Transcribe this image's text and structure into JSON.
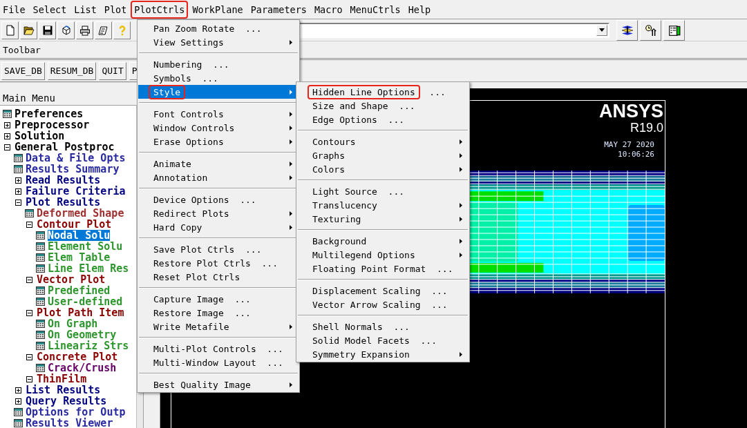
{
  "menubar": [
    {
      "label": "File",
      "highlighted": false
    },
    {
      "label": "Select",
      "highlighted": false
    },
    {
      "label": "List",
      "highlighted": false
    },
    {
      "label": "Plot",
      "highlighted": false
    },
    {
      "label": "PlotCtrls",
      "highlighted": true
    },
    {
      "label": "WorkPlane",
      "highlighted": false
    },
    {
      "label": "Parameters",
      "highlighted": false
    },
    {
      "label": "Macro",
      "highlighted": false
    },
    {
      "label": "MenuCtrls",
      "highlighted": false
    },
    {
      "label": "Help",
      "highlighted": false
    }
  ],
  "toolbar_title": "Toolbar",
  "toolbar_buttons": [
    "SAVE_DB",
    "RESUM_DB",
    "QUIT",
    "P"
  ],
  "main_menu": {
    "title": "Main Menu",
    "items": [
      {
        "label": "Preferences",
        "kind": "leaf",
        "selected": false,
        "color": "#000000"
      },
      {
        "label": "Preprocessor",
        "kind": "branch",
        "expanded": false,
        "selected": false,
        "color": "#000000"
      },
      {
        "label": "Solution",
        "kind": "branch",
        "expanded": false,
        "selected": false,
        "color": "#000000"
      },
      {
        "label": "General Postproc",
        "kind": "branch",
        "expanded": true,
        "selected": false,
        "color": "#000000",
        "children": [
          {
            "label": "Data & File Opts",
            "kind": "leaf",
            "selected": false,
            "color": "#2a2aa0"
          },
          {
            "label": "Results Summary",
            "kind": "leaf",
            "selected": false,
            "color": "#2a2aa0"
          },
          {
            "label": "Read Results",
            "kind": "branch",
            "expanded": false,
            "selected": false,
            "color": "#000080"
          },
          {
            "label": "Failure Criteria",
            "kind": "branch",
            "expanded": false,
            "selected": false,
            "color": "#000080"
          },
          {
            "label": "Plot Results",
            "kind": "branch",
            "expanded": true,
            "selected": false,
            "color": "#000080",
            "children": [
              {
                "label": "Deformed Shape",
                "kind": "leaf",
                "selected": false,
                "color": "#a03030"
              },
              {
                "label": "Contour Plot",
                "kind": "branch",
                "expanded": true,
                "selected": false,
                "color": "#8b0000",
                "children": [
                  {
                    "label": "Nodal Solu",
                    "kind": "leaf",
                    "selected": true
                  },
                  {
                    "label": "Element Solu",
                    "kind": "leaf",
                    "selected": false,
                    "color": "#2e962e"
                  },
                  {
                    "label": "Elem Table",
                    "kind": "leaf",
                    "selected": false,
                    "color": "#2e962e"
                  },
                  {
                    "label": "Line Elem Res",
                    "kind": "leaf",
                    "selected": false,
                    "color": "#2e962e"
                  }
                ]
              },
              {
                "label": "Vector Plot",
                "kind": "branch",
                "expanded": true,
                "selected": false,
                "color": "#8b0000",
                "children": [
                  {
                    "label": "Predefined",
                    "kind": "leaf",
                    "selected": false,
                    "color": "#2e962e"
                  },
                  {
                    "label": "User-defined",
                    "kind": "leaf",
                    "selected": false,
                    "color": "#2e962e"
                  }
                ]
              },
              {
                "label": "Plot Path Item",
                "kind": "branch",
                "expanded": true,
                "selected": false,
                "color": "#8b0000",
                "children": [
                  {
                    "label": "On Graph",
                    "kind": "leaf",
                    "selected": false,
                    "color": "#2e962e"
                  },
                  {
                    "label": "On Geometry",
                    "kind": "leaf",
                    "selected": false,
                    "color": "#2e962e"
                  },
                  {
                    "label": "Lineariz Strs",
                    "kind": "leaf",
                    "selected": false,
                    "color": "#2e962e"
                  }
                ]
              },
              {
                "label": "Concrete Plot",
                "kind": "branch",
                "expanded": true,
                "selected": false,
                "color": "#8b0000",
                "children": [
                  {
                    "label": "Crack/Crush",
                    "kind": "leaf",
                    "selected": false,
                    "color": "#660066"
                  }
                ]
              },
              {
                "label": "ThinFilm",
                "kind": "branch",
                "expanded": true,
                "selected": false,
                "color": "#8b0000"
              }
            ]
          },
          {
            "label": "List Results",
            "kind": "branch",
            "expanded": false,
            "selected": false,
            "color": "#000080"
          },
          {
            "label": "Query Results",
            "kind": "branch",
            "expanded": false,
            "selected": false,
            "color": "#000080"
          },
          {
            "label": "Options for Outp",
            "kind": "leaf",
            "selected": false,
            "color": "#2a2aa0"
          },
          {
            "label": "Results Viewer",
            "kind": "leaf",
            "selected": false,
            "color": "#2a2aa0"
          }
        ]
      }
    ]
  },
  "graphics": {
    "logo": "ANSYS",
    "version": "R19.0",
    "date": "MAY 27 2020",
    "time": "10:06:26"
  },
  "plotctrls_menu": {
    "groups": [
      {
        "items": [
          {
            "label": "Pan Zoom Rotate",
            "suffix": "...",
            "submenu": false,
            "selected": false,
            "highlighted": false
          },
          {
            "label": "View Settings",
            "submenu": true,
            "selected": false,
            "highlighted": false
          }
        ]
      },
      {
        "items": [
          {
            "label": "Numbering",
            "suffix": "...",
            "submenu": false,
            "selected": false,
            "highlighted": false
          },
          {
            "label": "Symbols",
            "suffix": "...",
            "submenu": false,
            "selected": false,
            "highlighted": false
          },
          {
            "label": "Style",
            "submenu": true,
            "selected": true,
            "highlighted": true
          }
        ]
      },
      {
        "items": [
          {
            "label": "Font Controls",
            "submenu": true,
            "selected": false,
            "highlighted": false
          },
          {
            "label": "Window Controls",
            "submenu": true,
            "selected": false,
            "highlighted": false
          },
          {
            "label": "Erase Options",
            "submenu": true,
            "selected": false,
            "highlighted": false
          }
        ]
      },
      {
        "items": [
          {
            "label": "Animate",
            "submenu": true,
            "selected": false,
            "highlighted": false
          },
          {
            "label": "Annotation",
            "submenu": true,
            "selected": false,
            "highlighted": false
          }
        ]
      },
      {
        "items": [
          {
            "label": "Device Options",
            "suffix": "...",
            "submenu": false,
            "selected": false,
            "highlighted": false
          },
          {
            "label": "Redirect Plots",
            "submenu": true,
            "selected": false,
            "highlighted": false
          },
          {
            "label": "Hard Copy",
            "submenu": true,
            "selected": false,
            "highlighted": false
          }
        ]
      },
      {
        "items": [
          {
            "label": "Save Plot Ctrls",
            "suffix": "...",
            "submenu": false,
            "selected": false,
            "highlighted": false
          },
          {
            "label": "Restore Plot Ctrls",
            "suffix": "...",
            "submenu": false,
            "selected": false,
            "highlighted": false
          },
          {
            "label": "Reset Plot Ctrls",
            "submenu": false,
            "selected": false,
            "highlighted": false
          }
        ]
      },
      {
        "items": [
          {
            "label": "Capture Image",
            "suffix": "...",
            "submenu": false,
            "selected": false,
            "highlighted": false
          },
          {
            "label": "Restore Image",
            "suffix": "...",
            "submenu": false,
            "selected": false,
            "highlighted": false
          },
          {
            "label": "Write Metafile",
            "submenu": true,
            "selected": false,
            "highlighted": false
          }
        ]
      },
      {
        "items": [
          {
            "label": "Multi-Plot Controls",
            "suffix": "...",
            "submenu": false,
            "selected": false,
            "highlighted": false
          },
          {
            "label": "Multi-Window Layout",
            "suffix": "...",
            "submenu": false,
            "selected": false,
            "highlighted": false
          }
        ]
      },
      {
        "items": [
          {
            "label": "Best Quality Image",
            "submenu": true,
            "selected": false,
            "highlighted": false
          }
        ]
      }
    ]
  },
  "style_submenu": {
    "groups": [
      {
        "items": [
          {
            "label": "Hidden Line Options",
            "suffix": "...",
            "submenu": false,
            "selected": false,
            "highlighted": true
          },
          {
            "label": "Size and Shape",
            "suffix": "...",
            "submenu": false,
            "selected": false,
            "highlighted": false
          },
          {
            "label": "Edge Options",
            "suffix": "...",
            "submenu": false,
            "selected": false,
            "highlighted": false
          }
        ]
      },
      {
        "items": [
          {
            "label": "Contours",
            "submenu": true,
            "selected": false,
            "highlighted": false
          },
          {
            "label": "Graphs",
            "submenu": true,
            "selected": false,
            "highlighted": false
          },
          {
            "label": "Colors",
            "submenu": true,
            "selected": false,
            "highlighted": false
          }
        ]
      },
      {
        "items": [
          {
            "label": "Light Source",
            "suffix": "...",
            "submenu": false,
            "selected": false,
            "highlighted": false
          },
          {
            "label": "Translucency",
            "submenu": true,
            "selected": false,
            "highlighted": false
          },
          {
            "label": "Texturing",
            "submenu": true,
            "selected": false,
            "highlighted": false
          }
        ]
      },
      {
        "items": [
          {
            "label": "Background",
            "submenu": true,
            "selected": false,
            "highlighted": false
          },
          {
            "label": "Multilegend Options",
            "submenu": true,
            "selected": false,
            "highlighted": false
          },
          {
            "label": "Floating Point Format",
            "suffix": "...",
            "submenu": false,
            "selected": false,
            "highlighted": false
          }
        ]
      },
      {
        "items": [
          {
            "label": "Displacement Scaling",
            "suffix": "...",
            "submenu": false,
            "selected": false,
            "highlighted": false
          },
          {
            "label": "Vector Arrow Scaling",
            "suffix": "...",
            "submenu": false,
            "selected": false,
            "highlighted": false
          }
        ]
      },
      {
        "items": [
          {
            "label": "Shell Normals",
            "suffix": "...",
            "submenu": false,
            "selected": false,
            "highlighted": false
          },
          {
            "label": "Solid Model Facets",
            "suffix": "...",
            "submenu": false,
            "selected": false,
            "highlighted": false
          },
          {
            "label": "Symmetry Expansion",
            "submenu": true,
            "selected": false,
            "highlighted": false
          }
        ]
      }
    ]
  }
}
